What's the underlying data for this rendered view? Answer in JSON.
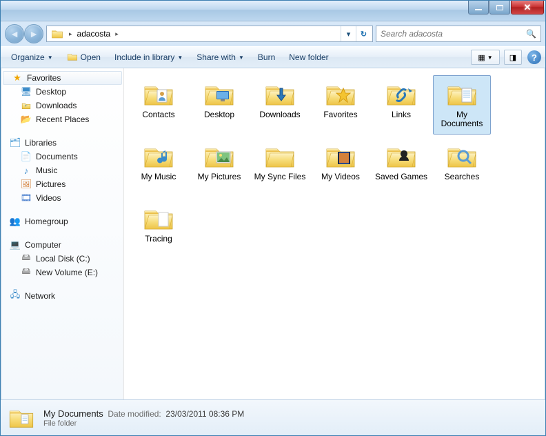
{
  "titlebar": {},
  "nav": {
    "breadcrumb": [
      "adacosta"
    ]
  },
  "search": {
    "placeholder": "Search adacosta"
  },
  "toolbar": {
    "organize": "Organize",
    "open": "Open",
    "include": "Include in library",
    "share": "Share with",
    "burn": "Burn",
    "newfolder": "New folder"
  },
  "sidebar": {
    "favorites": {
      "label": "Favorites",
      "items": [
        {
          "label": "Desktop",
          "icon": "desktop"
        },
        {
          "label": "Downloads",
          "icon": "downloads"
        },
        {
          "label": "Recent Places",
          "icon": "recent"
        }
      ]
    },
    "libraries": {
      "label": "Libraries",
      "items": [
        {
          "label": "Documents",
          "icon": "doc"
        },
        {
          "label": "Music",
          "icon": "music"
        },
        {
          "label": "Pictures",
          "icon": "pic"
        },
        {
          "label": "Videos",
          "icon": "video"
        }
      ]
    },
    "homegroup": {
      "label": "Homegroup"
    },
    "computer": {
      "label": "Computer",
      "items": [
        {
          "label": "Local Disk (C:)"
        },
        {
          "label": "New Volume (E:)"
        }
      ]
    },
    "network": {
      "label": "Network"
    }
  },
  "files": [
    {
      "label": "Contacts",
      "icon": "contacts"
    },
    {
      "label": "Desktop",
      "icon": "desktop-f"
    },
    {
      "label": "Downloads",
      "icon": "downloads-f"
    },
    {
      "label": "Favorites",
      "icon": "favorites-f"
    },
    {
      "label": "Links",
      "icon": "links-f"
    },
    {
      "label": "My Documents",
      "icon": "mydocs",
      "selected": true
    },
    {
      "label": "My Music",
      "icon": "mymusic"
    },
    {
      "label": "My Pictures",
      "icon": "mypics"
    },
    {
      "label": "My Sync Files",
      "icon": "sync"
    },
    {
      "label": "My Videos",
      "icon": "myvideos"
    },
    {
      "label": "Saved Games",
      "icon": "games"
    },
    {
      "label": "Searches",
      "icon": "searches"
    },
    {
      "label": "Tracing",
      "icon": "plain"
    }
  ],
  "details": {
    "name": "My Documents",
    "type": "File folder",
    "modified_label": "Date modified:",
    "modified_value": "23/03/2011 08:36 PM"
  }
}
